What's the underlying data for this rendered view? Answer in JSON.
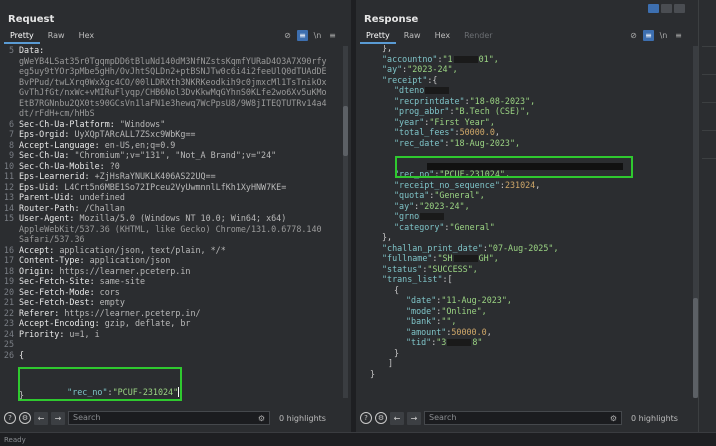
{
  "request": {
    "title": "Request",
    "tabs": [
      "Pretty",
      "Raw",
      "Hex"
    ],
    "active_tab": "Pretty",
    "lines": [
      {
        "n": "5",
        "name": "Data:",
        "value": ""
      },
      {
        "n": "",
        "name": "",
        "value": "gWeYB4LSat35r0TgqmpDD6tBluNd140dM3NfNZstsKqmfYURaD4O3A7X90rfy"
      },
      {
        "n": "",
        "name": "",
        "value": "eg5uy9tYOr3pMbe5gHh/OvJhtSQLDn2+ptBSNJTw0c6i4i2feeUlQ0dTUAdDE"
      },
      {
        "n": "",
        "name": "",
        "value": "BvPPud/twLXrq0WxXgc4CO/00lLDRXth3NKRKeodkih9c0jmxcMl1TsTnikOx"
      },
      {
        "n": "",
        "name": "",
        "value": "GvThJfGt/nxWc+vMIRuFlyqp/CHB6Nol3DvKkwMqGYhnS0KLfe2wo6Xv5uKMo"
      },
      {
        "n": "",
        "name": "",
        "value": "EtB7RGNnbu2QX0ts90GCsVn1laFN1e3hewq7WcPpsU8/9W8jITEQTUTRv14a4"
      },
      {
        "n": "",
        "name": "",
        "value": "dt/rFdH+cm/hHbS"
      },
      {
        "n": "6",
        "name": "Sec-Ch-Ua-Platform:",
        "value": " \"Windows\""
      },
      {
        "n": "7",
        "name": "Eps-Orgid:",
        "value": " UyXQpTARcALL7ZSxc9WbKg=="
      },
      {
        "n": "8",
        "name": "Accept-Language:",
        "value": " en-US,en;q=0.9"
      },
      {
        "n": "9",
        "name": "Sec-Ch-Ua:",
        "value": " \"Chromium\";v=\"131\", \"Not_A Brand\";v=\"24\""
      },
      {
        "n": "10",
        "name": "Sec-Ch-Ua-Mobile:",
        "value": " ?0"
      },
      {
        "n": "11",
        "name": "Eps-Learnerid:",
        "value": " +ZjHsRaYNUKLK406AS22UQ=="
      },
      {
        "n": "12",
        "name": "Eps-Uid:",
        "value": " L4Crt5n6MBE1So72IPceu2VyUwmnnlLfKh1XyHNW7KE="
      },
      {
        "n": "13",
        "name": "Parent-Uid:",
        "value": " undefined"
      },
      {
        "n": "14",
        "name": "Router-Path:",
        "value": " /Challan"
      },
      {
        "n": "15",
        "name": "User-Agent:",
        "value": " Mozilla/5.0 (Windows NT 10.0; Win64; x64)"
      },
      {
        "n": "",
        "name": "",
        "value": "AppleWebKit/537.36 (KHTML, like Gecko) Chrome/131.0.6778.140"
      },
      {
        "n": "",
        "name": "",
        "value": "Safari/537.36"
      },
      {
        "n": "16",
        "name": "Accept:",
        "value": " application/json, text/plain, */*"
      },
      {
        "n": "17",
        "name": "Content-Type:",
        "value": " application/json"
      },
      {
        "n": "18",
        "name": "Origin:",
        "value": " https://learner.pceterp.in"
      },
      {
        "n": "19",
        "name": "Sec-Fetch-Site:",
        "value": " same-site"
      },
      {
        "n": "20",
        "name": "Sec-Fetch-Mode:",
        "value": " cors"
      },
      {
        "n": "21",
        "name": "Sec-Fetch-Dest:",
        "value": " empty"
      },
      {
        "n": "22",
        "name": "Referer:",
        "value": " https://learner.pceterp.in/"
      },
      {
        "n": "23",
        "name": "Accept-Encoding:",
        "value": " gzip, deflate, br"
      },
      {
        "n": "24",
        "name": "Priority:",
        "value": " u=1, i"
      },
      {
        "n": "25",
        "name": "",
        "value": ""
      },
      {
        "n": "26",
        "name": "{",
        "value": ""
      }
    ],
    "body_key": "\"rec_no\"",
    "body_sep": ":",
    "body_value": "\"PCUF-231024\"",
    "body_close": "}",
    "search_placeholder": "Search",
    "highlights": "0 highlights"
  },
  "response": {
    "title": "Response",
    "tabs": [
      "Pretty",
      "Raw",
      "Hex",
      "Render"
    ],
    "active_tab": "Pretty",
    "search_placeholder": "Search",
    "highlights": "0 highlights",
    "lines": [
      {
        "indent": 2,
        "segs": [
          {
            "c": "jp",
            "t": "},"
          }
        ]
      },
      {
        "indent": 2,
        "segs": [
          {
            "c": "jk",
            "t": "\"accountno\""
          },
          {
            "c": "jp",
            "t": ":"
          },
          {
            "c": "js",
            "t": "\"1"
          },
          {
            "c": "redact",
            "t": ""
          },
          {
            "c": "js",
            "t": "01\","
          }
        ]
      },
      {
        "indent": 2,
        "segs": [
          {
            "c": "jk",
            "t": "\"ay\""
          },
          {
            "c": "jp",
            "t": ":"
          },
          {
            "c": "js",
            "t": "\"2023-24\","
          }
        ]
      },
      {
        "indent": 2,
        "segs": [
          {
            "c": "jk",
            "t": "\"receipt\""
          },
          {
            "c": "jp",
            "t": ":{"
          }
        ]
      },
      {
        "indent": 4,
        "segs": [
          {
            "c": "jk",
            "t": "\"dteno"
          },
          {
            "c": "redact",
            "t": ""
          }
        ]
      },
      {
        "indent": 4,
        "segs": [
          {
            "c": "jk",
            "t": "\"recprintdate\""
          },
          {
            "c": "jp",
            "t": ":"
          },
          {
            "c": "js",
            "t": "\"18-08-2023\","
          }
        ]
      },
      {
        "indent": 4,
        "segs": [
          {
            "c": "jk",
            "t": "\"prog_abbr\""
          },
          {
            "c": "jp",
            "t": ":"
          },
          {
            "c": "js",
            "t": "\"B.Tech (CSE)\","
          }
        ]
      },
      {
        "indent": 4,
        "segs": [
          {
            "c": "jk",
            "t": "\"year\""
          },
          {
            "c": "jp",
            "t": ":"
          },
          {
            "c": "js",
            "t": "\"First Year\","
          }
        ]
      },
      {
        "indent": 4,
        "segs": [
          {
            "c": "jk",
            "t": "\"total_fees\""
          },
          {
            "c": "jp",
            "t": ":"
          },
          {
            "c": "jn",
            "t": "50000.0"
          },
          {
            "c": "jp",
            "t": ","
          }
        ]
      },
      {
        "indent": 4,
        "segs": [
          {
            "c": "jk",
            "t": "\"rec_date\""
          },
          {
            "c": "jp",
            "t": ":"
          },
          {
            "c": "js",
            "t": "\"18-Aug-2023\","
          }
        ]
      },
      {
        "indent": 4,
        "segs": []
      },
      {
        "indent": 4,
        "segs": []
      },
      {
        "indent": 4,
        "segs": [
          {
            "c": "jk",
            "t": "\"rec_no\""
          },
          {
            "c": "jp",
            "t": ":"
          },
          {
            "c": "js",
            "t": "\"PCUF-231024\","
          }
        ]
      },
      {
        "indent": 4,
        "segs": [
          {
            "c": "jk",
            "t": "\"receipt_no_sequence\""
          },
          {
            "c": "jp",
            "t": ":"
          },
          {
            "c": "jn",
            "t": "231024"
          },
          {
            "c": "jp",
            "t": ","
          }
        ]
      },
      {
        "indent": 4,
        "segs": [
          {
            "c": "jk",
            "t": "\"quota\""
          },
          {
            "c": "jp",
            "t": ":"
          },
          {
            "c": "js",
            "t": "\"General\","
          }
        ]
      },
      {
        "indent": 4,
        "segs": [
          {
            "c": "jk",
            "t": "\"ay\""
          },
          {
            "c": "jp",
            "t": ":"
          },
          {
            "c": "js",
            "t": "\"2023-24\","
          }
        ]
      },
      {
        "indent": 4,
        "segs": [
          {
            "c": "jk",
            "t": "\"grno"
          },
          {
            "c": "redact",
            "t": ""
          }
        ]
      },
      {
        "indent": 4,
        "segs": [
          {
            "c": "jk",
            "t": "\"category\""
          },
          {
            "c": "jp",
            "t": ":"
          },
          {
            "c": "js",
            "t": "\"General\""
          }
        ]
      },
      {
        "indent": 2,
        "segs": [
          {
            "c": "jp",
            "t": "},"
          }
        ]
      },
      {
        "indent": 2,
        "segs": [
          {
            "c": "jk",
            "t": "\"challan_print_date\""
          },
          {
            "c": "jp",
            "t": ":"
          },
          {
            "c": "js",
            "t": "\"07-Aug-2025\","
          }
        ]
      },
      {
        "indent": 2,
        "segs": [
          {
            "c": "jk",
            "t": "\"fullname\""
          },
          {
            "c": "jp",
            "t": ":"
          },
          {
            "c": "js",
            "t": "\"SH"
          },
          {
            "c": "redact",
            "t": ""
          },
          {
            "c": "js",
            "t": "GH\","
          }
        ]
      },
      {
        "indent": 2,
        "segs": [
          {
            "c": "jk",
            "t": "\"status\""
          },
          {
            "c": "jp",
            "t": ":"
          },
          {
            "c": "js",
            "t": "\"SUCCESS\","
          }
        ]
      },
      {
        "indent": 2,
        "segs": [
          {
            "c": "jk",
            "t": "\"trans_list\""
          },
          {
            "c": "jp",
            "t": ":["
          }
        ]
      },
      {
        "indent": 4,
        "segs": [
          {
            "c": "jp",
            "t": "{"
          }
        ]
      },
      {
        "indent": 6,
        "segs": [
          {
            "c": "jk",
            "t": "\"date\""
          },
          {
            "c": "jp",
            "t": ":"
          },
          {
            "c": "js",
            "t": "\"11-Aug-2023\","
          }
        ]
      },
      {
        "indent": 6,
        "segs": [
          {
            "c": "jk",
            "t": "\"mode\""
          },
          {
            "c": "jp",
            "t": ":"
          },
          {
            "c": "js",
            "t": "\"Online\","
          }
        ]
      },
      {
        "indent": 6,
        "segs": [
          {
            "c": "jk",
            "t": "\"bank\""
          },
          {
            "c": "jp",
            "t": ":"
          },
          {
            "c": "js",
            "t": "\"\","
          }
        ]
      },
      {
        "indent": 6,
        "segs": [
          {
            "c": "jk",
            "t": "\"amount\""
          },
          {
            "c": "jp",
            "t": ":"
          },
          {
            "c": "jn",
            "t": "50000.0"
          },
          {
            "c": "jp",
            "t": ","
          }
        ]
      },
      {
        "indent": 6,
        "segs": [
          {
            "c": "jk",
            "t": "\"tid\""
          },
          {
            "c": "jp",
            "t": ":"
          },
          {
            "c": "js",
            "t": "\"3"
          },
          {
            "c": "redact",
            "t": ""
          },
          {
            "c": "js",
            "t": "8\""
          }
        ]
      },
      {
        "indent": 4,
        "segs": [
          {
            "c": "jp",
            "t": "}"
          }
        ]
      },
      {
        "indent": 3,
        "segs": [
          {
            "c": "jp",
            "t": "]"
          }
        ]
      },
      {
        "indent": 0,
        "segs": [
          {
            "c": "jp",
            "t": "}"
          }
        ]
      }
    ]
  },
  "status_bar": "Ready",
  "colors": {
    "highlight_box": "#2fc92f",
    "key": "#7fc4c8",
    "string": "#9bd483",
    "number": "#d0a869",
    "accent": "#3d6fb0"
  }
}
